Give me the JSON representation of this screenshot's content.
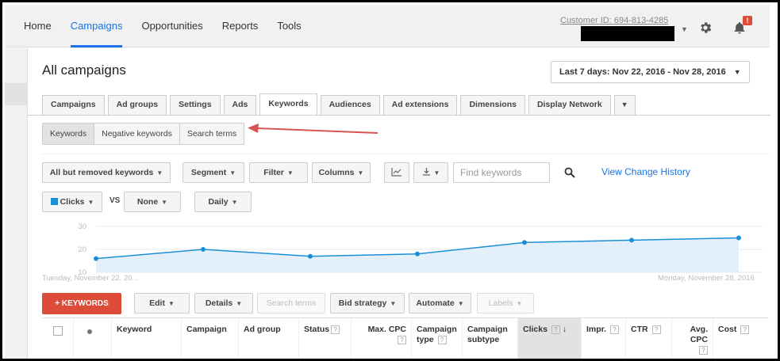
{
  "nav": {
    "items": [
      "Home",
      "Campaigns",
      "Opportunities",
      "Reports",
      "Tools"
    ],
    "active_index": 1
  },
  "account": {
    "customer_id": "Customer ID: 694-813-4285",
    "notification_badge": "!"
  },
  "page": {
    "title": "All campaigns",
    "date_range": "Last 7 days: Nov 22, 2016 - Nov 28, 2016"
  },
  "tabs": [
    "Campaigns",
    "Ad groups",
    "Settings",
    "Ads",
    "Keywords",
    "Audiences",
    "Ad extensions",
    "Dimensions",
    "Display Network"
  ],
  "active_tab": "Keywords",
  "subtabs": [
    "Keywords",
    "Negative keywords",
    "Search terms"
  ],
  "toolbar": {
    "filter_view": "All but removed keywords",
    "segment": "Segment",
    "filter": "Filter",
    "columns": "Columns",
    "search_placeholder": "Find keywords",
    "history_link": "View Change History"
  },
  "chart_controls": {
    "metric1": "Clicks",
    "vs": "VS",
    "metric2": "None",
    "interval": "Daily"
  },
  "colors": {
    "accent": "#1a73e8",
    "series": "#1a8fd8",
    "add_button": "#dd4b39"
  },
  "chart_data": {
    "type": "area",
    "x": [
      "2016-11-22",
      "2016-11-23",
      "2016-11-24",
      "2016-11-25",
      "2016-11-26",
      "2016-11-27",
      "2016-11-28"
    ],
    "series": [
      {
        "name": "Clicks",
        "values": [
          16,
          20,
          17,
          18,
          23,
          24,
          25
        ]
      }
    ],
    "ylim": [
      10,
      30
    ],
    "yticks": [
      10,
      20,
      30
    ],
    "x_start_label": "Tuesday, November 22, 20...",
    "x_end_label": "Monday, November 28, 2016",
    "grid": true
  },
  "actions": {
    "add_keywords": "+ KEYWORDS",
    "edit": "Edit",
    "details": "Details",
    "search_terms": "Search terms",
    "bid_strategy": "Bid strategy",
    "automate": "Automate",
    "labels": "Labels"
  },
  "table": {
    "headers": [
      "Keyword",
      "Campaign",
      "Ad group",
      "Status",
      "Max. CPC",
      "Campaign type",
      "Campaign subtype",
      "Clicks",
      "Impr.",
      "CTR",
      "Avg. CPC",
      "Cost"
    ],
    "sorted_column": "Clicks"
  }
}
